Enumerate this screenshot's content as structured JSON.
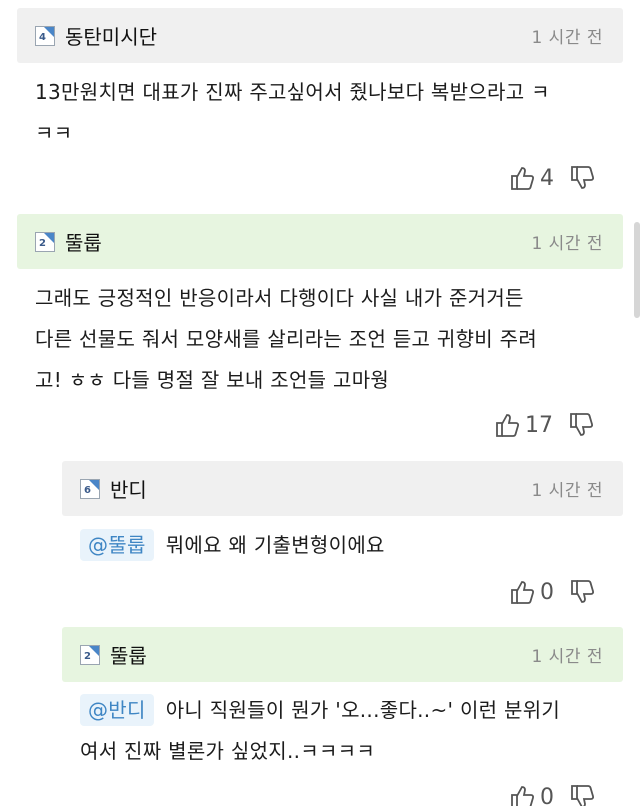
{
  "comments": [
    {
      "nick": "동탄미시단",
      "level": "4",
      "time": "1 시간 전",
      "line1": "13만원치면 대표가 진짜 주고싶어서 줬나보다 복받으라고 ㅋ",
      "line2": "ㅋㅋ",
      "likes": "4"
    },
    {
      "nick": "뚤룹",
      "level": "2",
      "time": "1 시간 전",
      "line1": "그래도 긍정적인 반응이라서 다행이다 사실 내가 준거거든",
      "line2": "다른 선물도 줘서 모양새를 살리라는 조언 듣고 귀향비 주려",
      "line3": "고! ㅎㅎ 다들 명절 잘 보내 조언들 고마웡",
      "likes": "17"
    },
    {
      "nick": "반디",
      "level": "6",
      "time": "1 시간 전",
      "mention": "@뚤룹",
      "line1": "뭐에요 왜 기출변형이에요",
      "likes": "0"
    },
    {
      "nick": "뚤룹",
      "level": "2",
      "time": "1 시간 전",
      "mention": "@반디",
      "line1": "아니 직원들이 뭔가 '오...좋다..~' 이런 분위기",
      "line2": "여서 진짜 별론가 싶었지..ㅋㅋㅋㅋ",
      "likes": "0"
    }
  ],
  "icons": {
    "like": "thumbs-up-icon",
    "dislike": "thumbs-down-icon",
    "level": "level-badge-icon"
  }
}
